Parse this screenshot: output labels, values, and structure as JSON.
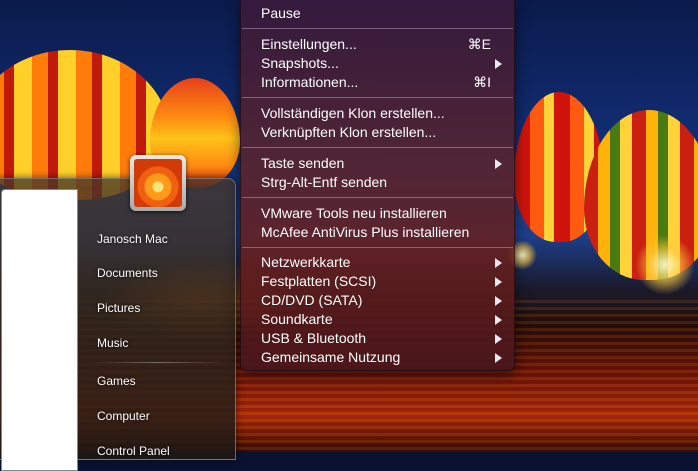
{
  "context_menu": {
    "items": [
      {
        "label": "Pause",
        "shortcut": "",
        "submenu": false
      },
      {
        "label": "Einstellungen...",
        "shortcut": "⌘E",
        "submenu": false
      },
      {
        "label": "Snapshots...",
        "shortcut": "",
        "submenu": true
      },
      {
        "label": "Informationen...",
        "shortcut": "⌘I",
        "submenu": false
      },
      {
        "label": "Vollständigen Klon erstellen...",
        "shortcut": "",
        "submenu": false
      },
      {
        "label": "Verknüpften Klon erstellen...",
        "shortcut": "",
        "submenu": false
      },
      {
        "label": "Taste senden",
        "shortcut": "",
        "submenu": true
      },
      {
        "label": "Strg-Alt-Entf senden",
        "shortcut": "",
        "submenu": false
      },
      {
        "label": "VMware Tools neu installieren",
        "shortcut": "",
        "submenu": false
      },
      {
        "label": "McAfee AntiVirus Plus installieren",
        "shortcut": "",
        "submenu": false
      },
      {
        "label": "Netzwerkkarte",
        "shortcut": "",
        "submenu": true
      },
      {
        "label": "Festplatten (SCSI)",
        "shortcut": "",
        "submenu": true
      },
      {
        "label": "CD/DVD (SATA)",
        "shortcut": "",
        "submenu": true
      },
      {
        "label": "Soundkarte",
        "shortcut": "",
        "submenu": true
      },
      {
        "label": "USB & Bluetooth",
        "shortcut": "",
        "submenu": true
      },
      {
        "label": "Gemeinsame Nutzung",
        "shortcut": "",
        "submenu": true
      }
    ]
  },
  "start_menu": {
    "user_picture_icon": "flower-user-picture-icon",
    "items": [
      {
        "label": "Janosch Mac"
      },
      {
        "label": "Documents"
      },
      {
        "label": "Pictures"
      },
      {
        "label": "Music"
      },
      {
        "label": "Games"
      },
      {
        "label": "Computer"
      },
      {
        "label": "Control Panel"
      }
    ]
  },
  "icons": {
    "submenu_arrow": "chevron-right-icon",
    "user_tile": "flower-user-picture-icon"
  }
}
